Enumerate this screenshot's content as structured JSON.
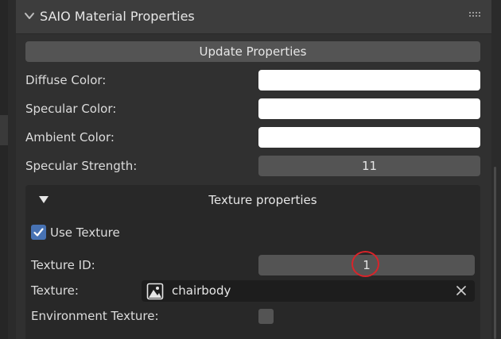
{
  "panel": {
    "title": "SAIO Material Properties",
    "update_button": "Update Properties",
    "rows": {
      "diffuse_label": "Diffuse Color:",
      "specular_label": "Specular Color:",
      "ambient_label": "Ambient Color:",
      "strength_label": "Specular Strength:",
      "strength_value": "11"
    },
    "colors": {
      "diffuse": "#ffffff",
      "specular": "#ffffff",
      "ambient": "#ffffff"
    }
  },
  "texture_panel": {
    "title": "Texture properties",
    "use_texture_label": "Use Texture",
    "use_texture_checked": true,
    "texture_id_label": "Texture ID:",
    "texture_id_value": "1",
    "texture_label": "Texture:",
    "texture_name": "chairbody",
    "env_texture_label": "Environment Texture:",
    "env_texture_checked": false
  },
  "accent_colors": {
    "checkbox": "#4772b3",
    "annotation": "#d8242a"
  },
  "icons": [
    "chevron-down-icon",
    "drag-handle-icon",
    "triangle-down-icon",
    "checkmark-icon",
    "image-icon",
    "close-icon"
  ]
}
